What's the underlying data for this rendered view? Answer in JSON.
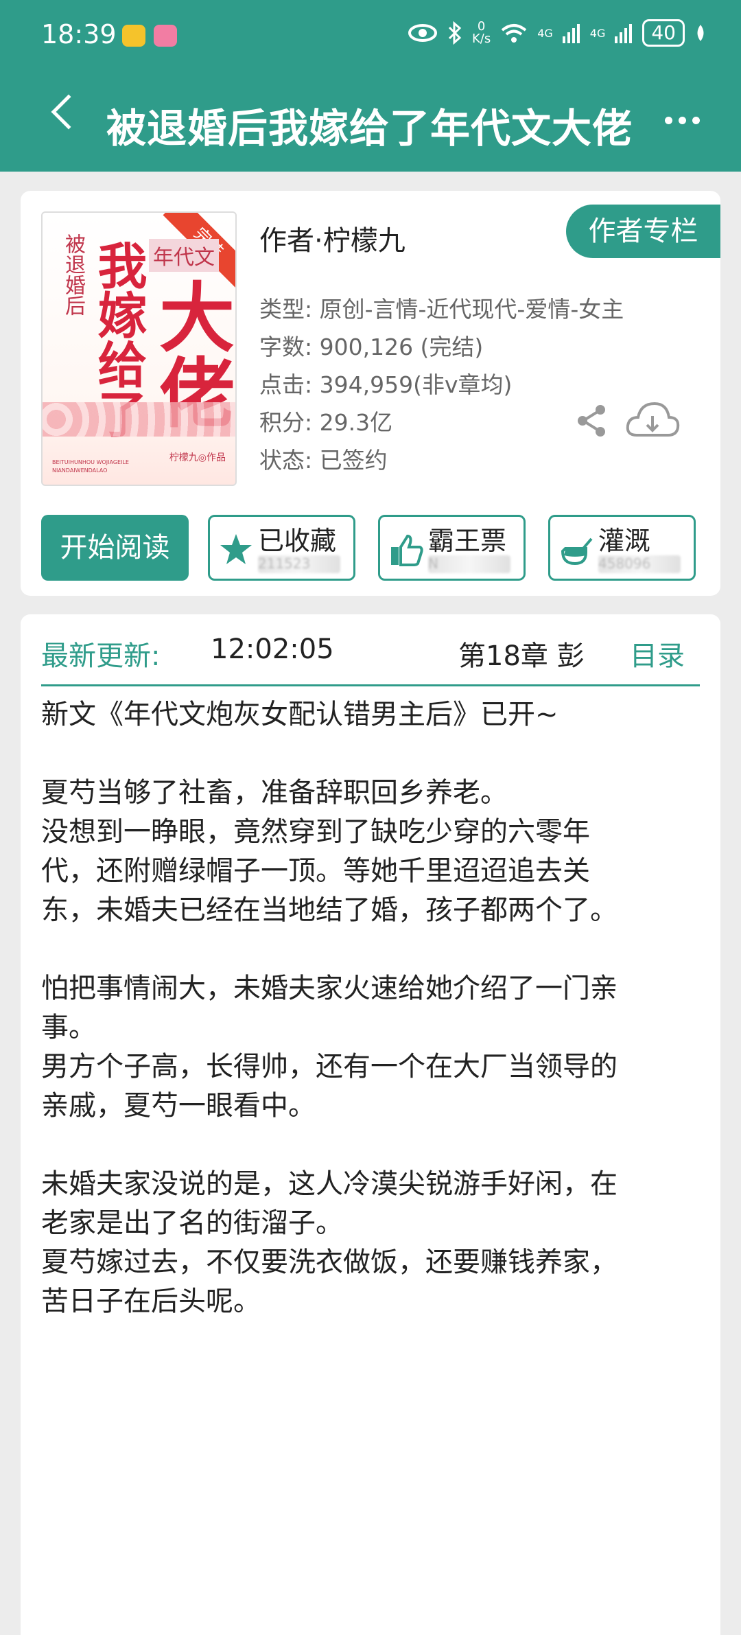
{
  "status_bar": {
    "time": "18:39",
    "network_speed": "0\nK/s",
    "signal1": "4G",
    "signal2": "4G",
    "battery": "40"
  },
  "header": {
    "title": "被退婚后我嫁给了年代文大佬"
  },
  "cover": {
    "ribbon": "完结",
    "tag": "年代文",
    "small_title": "被退婚后",
    "big1": "我嫁给了",
    "big2": "大佬",
    "author_mark": "柠檬九◎作品",
    "pinyin": "BEITUIHUNHOU WOJIAGEILE NIANDAIWENDALAO"
  },
  "book": {
    "author": "作者·柠檬九",
    "author_column": "作者专栏",
    "type": "类型: 原创-言情-近代现代-爱情-女主",
    "words": "字数: 900,126 (完结)",
    "clicks": "点击: 394,959(非v章均)",
    "points": "积分: 29.3亿",
    "status": "状态: 已签约"
  },
  "actions": {
    "start_read": "开始阅读",
    "collect": {
      "label": "已收藏",
      "count": "211523"
    },
    "ticket": {
      "label": "霸王票",
      "count": "N"
    },
    "nutrient": {
      "label": "灌溉",
      "count": "458096"
    }
  },
  "latest": {
    "label": "最新更新:",
    "time": "12:02:05",
    "chapter": "第18章  彭",
    "toc": "目录"
  },
  "intro": [
    "新文《年代文炮灰女配认错男主后》已开~",
    "",
    "夏芍当够了社畜，准备辞职回乡养老。",
    "没想到一睁眼，竟然穿到了缺吃少穿的六零年",
    "代，还附赠绿帽子一顶。等她千里迢迢追去关",
    "东，未婚夫已经在当地结了婚，孩子都两个了。",
    "",
    "怕把事情闹大，未婚夫家火速给她介绍了一门亲",
    "事。",
    "男方个子高，长得帅，还有一个在大厂当领导的",
    "亲戚，夏芍一眼看中。",
    "",
    "未婚夫家没说的是，这人冷漠尖锐游手好闲，在",
    "老家是出了名的街溜子。",
    "夏芍嫁过去，不仅要洗衣做饭，还要赚钱养家，",
    "苦日子在后头呢。"
  ],
  "colors": {
    "accent": "#2f9c8a",
    "cover_red": "#d8243c"
  }
}
